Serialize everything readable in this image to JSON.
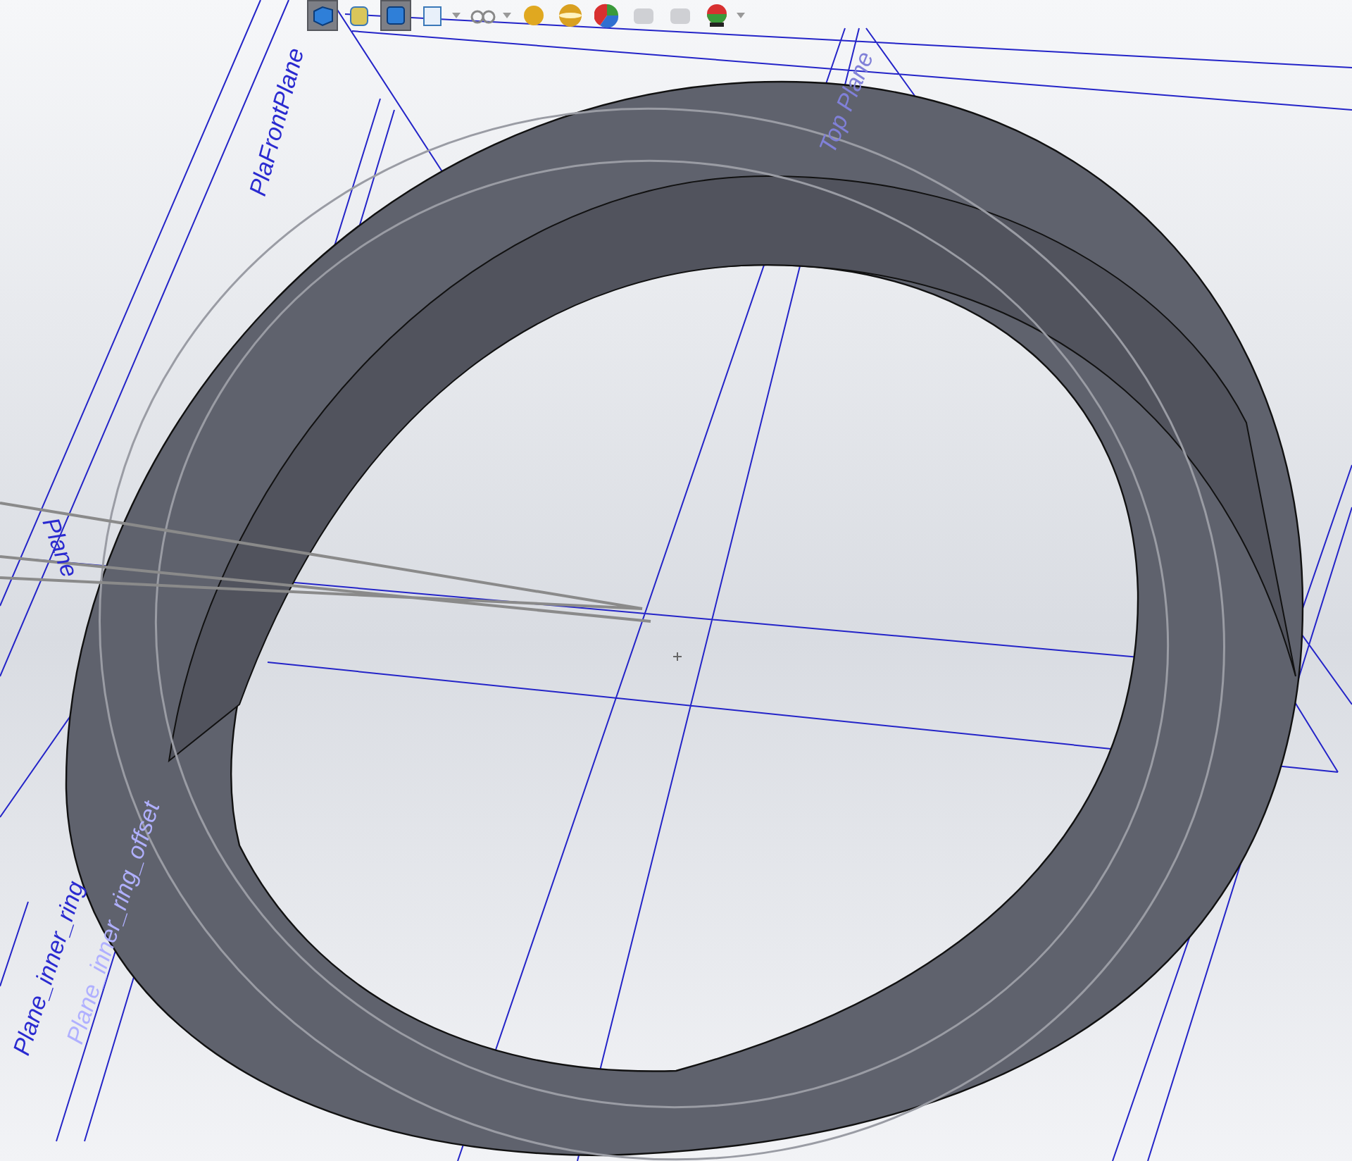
{
  "toolbar": {
    "buttons": [
      {
        "kind": "view",
        "selected": true,
        "dropdown": false
      },
      {
        "kind": "section",
        "selected": false,
        "dropdown": false
      },
      {
        "kind": "display",
        "selected": true,
        "dropdown": false
      },
      {
        "kind": "hide",
        "selected": false,
        "dropdown": true
      },
      {
        "kind": "glasses",
        "selected": false,
        "dropdown": true
      },
      {
        "kind": "sphere",
        "selected": false,
        "dropdown": false
      },
      {
        "kind": "scene",
        "selected": false,
        "dropdown": false
      },
      {
        "kind": "appearance",
        "selected": false,
        "dropdown": false
      },
      {
        "kind": "faded",
        "selected": false,
        "dropdown": false
      },
      {
        "kind": "faded",
        "selected": false,
        "dropdown": false
      },
      {
        "kind": "render",
        "selected": false,
        "dropdown": true
      }
    ]
  },
  "viewport": {
    "plane_labels": [
      {
        "text": "Top Plane",
        "kind": "top"
      },
      {
        "text": "PlaFrontPlane",
        "kind": "front"
      },
      {
        "text": "Plane",
        "kind": "side"
      },
      {
        "text": "Plane_inner_ring",
        "kind": "inner"
      },
      {
        "text": "Plane_inner_ring_offset",
        "kind": "offset"
      }
    ]
  }
}
